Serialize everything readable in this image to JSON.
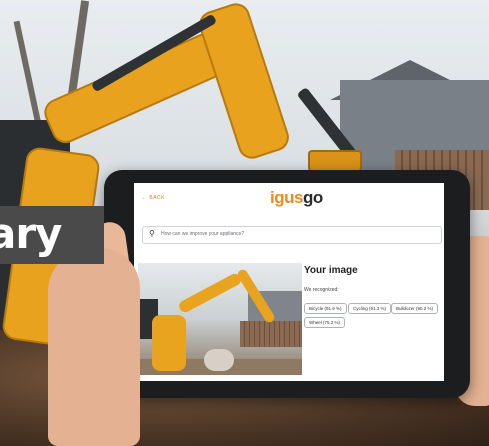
{
  "overlay": {
    "caption": "ary"
  },
  "app": {
    "back_label": "← BACK",
    "logo": {
      "part1": "igus",
      "part2": "go",
      "accent_color": "#f08a1c"
    },
    "search": {
      "placeholder": "How can we improve your appliance?"
    },
    "result": {
      "heading": "Your image",
      "recognized_label": "We recognized:",
      "chips": [
        {
          "label": "Bicycle (91.9 %)"
        },
        {
          "label": "Cycling (91.3 %)"
        },
        {
          "label": "Bulldozer (90.2 %)"
        },
        {
          "label": "Wheel (75.2 %)"
        }
      ]
    }
  }
}
